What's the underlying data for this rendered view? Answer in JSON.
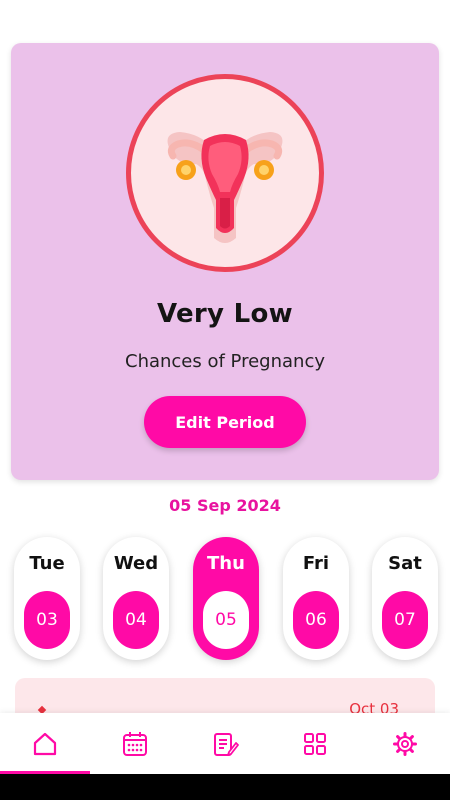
{
  "hero": {
    "status_title": "Very Low",
    "status_subtitle": "Chances of Pregnancy",
    "edit_button": "Edit Period",
    "illustration_icon": "uterus-icon"
  },
  "calendar": {
    "selected_date": "05 Sep 2024",
    "days": [
      {
        "name": "Tue",
        "num": "03",
        "selected": false
      },
      {
        "name": "Wed",
        "num": "04",
        "selected": false
      },
      {
        "name": "Thu",
        "num": "05",
        "selected": true
      },
      {
        "name": "Fri",
        "num": "06",
        "selected": false
      },
      {
        "name": "Sat",
        "num": "07",
        "selected": false
      }
    ]
  },
  "next_card": {
    "date": "Oct 03"
  },
  "nav": {
    "items": [
      {
        "icon": "home-icon",
        "active": true
      },
      {
        "icon": "calendar-icon",
        "active": false
      },
      {
        "icon": "notes-edit-icon",
        "active": false
      },
      {
        "icon": "grid-icon",
        "active": false
      },
      {
        "icon": "gear-icon",
        "active": false
      }
    ]
  },
  "colors": {
    "accent": "#ff0aa6",
    "card_bg": "#ebc1ea",
    "badge_ring": "#ec4358",
    "date_text": "#e8139f"
  }
}
